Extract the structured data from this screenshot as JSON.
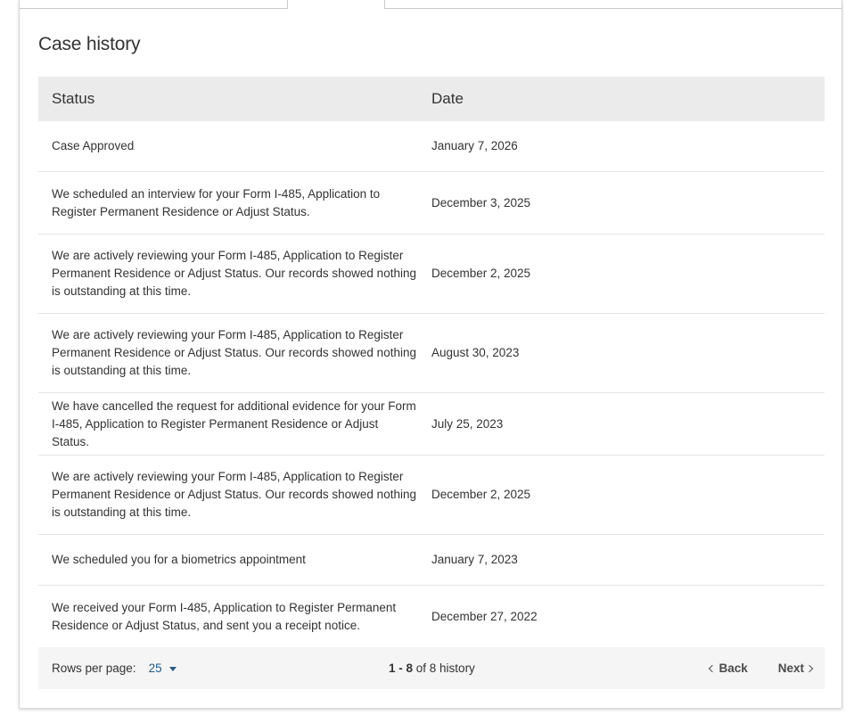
{
  "section": {
    "title": "Case history"
  },
  "table": {
    "headers": {
      "status": "Status",
      "date": "Date"
    },
    "rows": [
      {
        "status": "Case Approved",
        "date": "January 7, 2026"
      },
      {
        "status": "We scheduled an interview for your Form I-485, Application to Register Permanent Residence or Adjust Status.",
        "date": "December 3, 2025"
      },
      {
        "status": "We are actively reviewing your Form I-485, Application to Register Permanent Residence or Adjust Status. Our records showed nothing is outstanding at this time.",
        "date": "December 2, 2025"
      },
      {
        "status": "We are actively reviewing your Form I-485, Application to Register Permanent Residence or Adjust Status. Our records showed nothing is outstanding at this time.",
        "date": "August 30, 2023"
      },
      {
        "status": "We have cancelled the request for additional evidence for your Form I-485, Application to Register Permanent Residence or Adjust Status.",
        "date": "July 25, 2023"
      },
      {
        "status": "We are actively reviewing your Form I-485, Application to Register Permanent Residence or Adjust Status. Our records showed nothing is outstanding at this time.",
        "date": "December 2, 2025"
      },
      {
        "status": "We scheduled you for a biometrics appointment",
        "date": "January 7, 2023"
      },
      {
        "status": "We received your Form I-485, Application to Register Permanent Residence or Adjust Status, and sent you a receipt notice.",
        "date": "December 27, 2022"
      }
    ]
  },
  "footer": {
    "rows_per_page_label": "Rows per page:",
    "rows_per_page_value": "25",
    "range_start": "1",
    "range_sep": " - ",
    "range_end": "8",
    "range_of": " of 8 history",
    "back_label": "Back",
    "next_label": "Next"
  },
  "colors": {
    "header_bg": "#ebebeb",
    "footer_bg": "#f5f5f5",
    "link": "#1f5b8c",
    "text": "#333333"
  },
  "icons": {
    "rows_select": "caret-down-icon",
    "back": "chevron-left-icon",
    "next": "chevron-right-icon"
  }
}
